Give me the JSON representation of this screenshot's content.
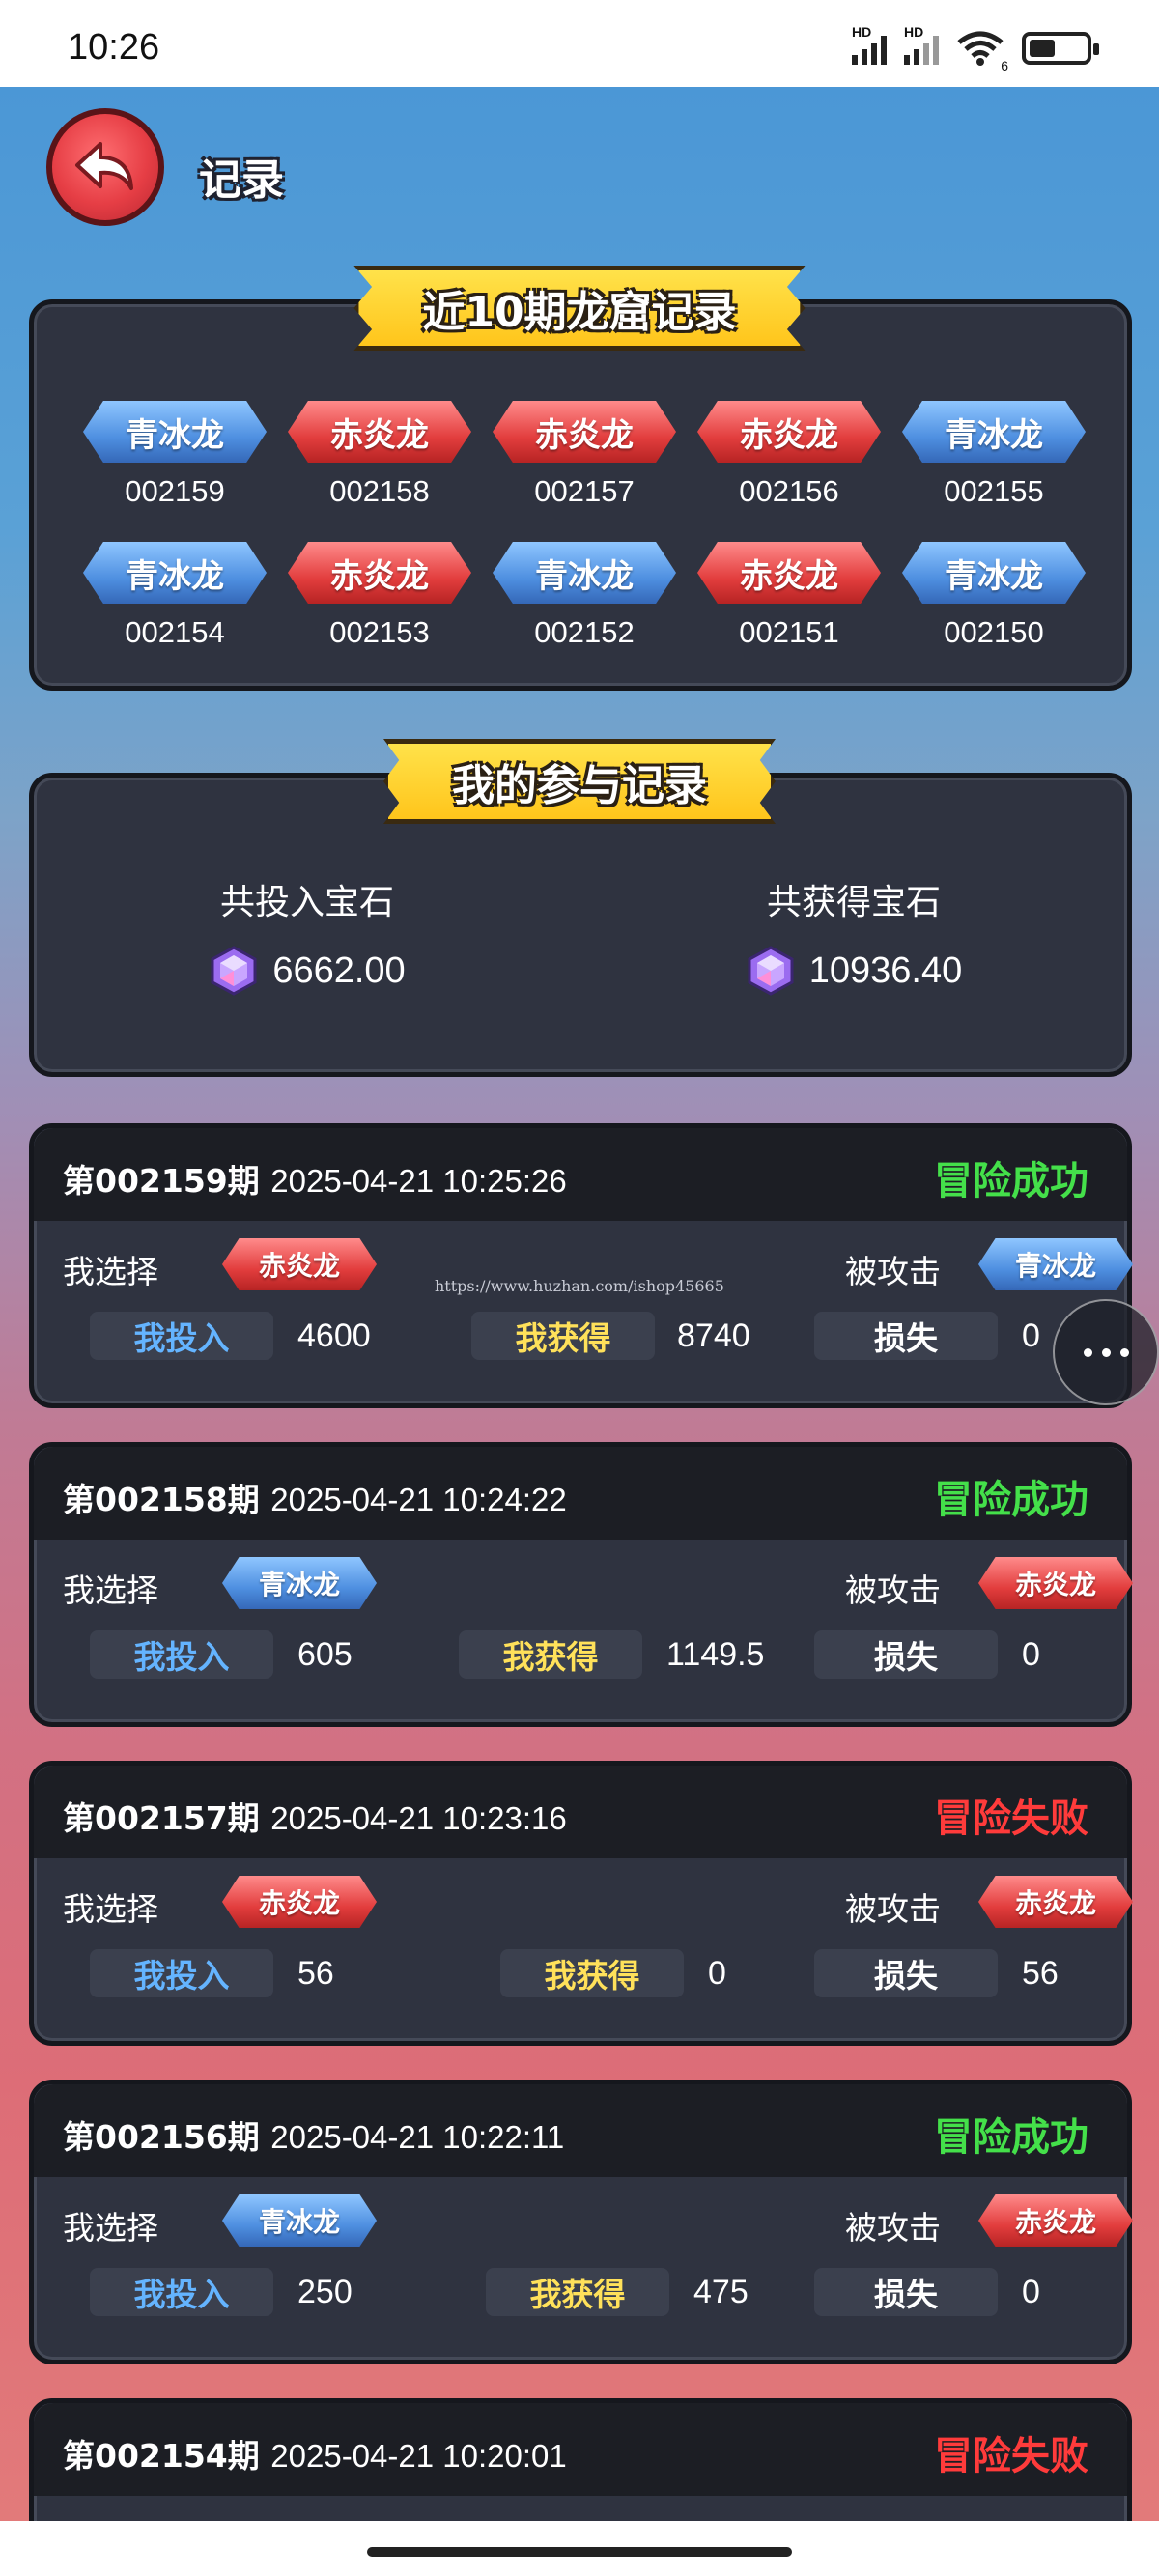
{
  "status_bar": {
    "time": "10:26",
    "signal1_label": "HD",
    "signal2_label": "HD",
    "wifi_badge": "6"
  },
  "header": {
    "title": "记录",
    "back_icon": "back-arrow-icon"
  },
  "history": {
    "title": "近10期龙窟记录",
    "items": [
      {
        "dragon": "青冰龙",
        "color": "blue",
        "period": "002159"
      },
      {
        "dragon": "赤炎龙",
        "color": "red",
        "period": "002158"
      },
      {
        "dragon": "赤炎龙",
        "color": "red",
        "period": "002157"
      },
      {
        "dragon": "赤炎龙",
        "color": "red",
        "period": "002156"
      },
      {
        "dragon": "青冰龙",
        "color": "blue",
        "period": "002155"
      },
      {
        "dragon": "青冰龙",
        "color": "blue",
        "period": "002154"
      },
      {
        "dragon": "赤炎龙",
        "color": "red",
        "period": "002153"
      },
      {
        "dragon": "青冰龙",
        "color": "blue",
        "period": "002152"
      },
      {
        "dragon": "赤炎龙",
        "color": "red",
        "period": "002151"
      },
      {
        "dragon": "青冰龙",
        "color": "blue",
        "period": "002150"
      }
    ]
  },
  "participation": {
    "title": "我的参与记录",
    "total_in_label": "共投入宝石",
    "total_in_value": "6662.00",
    "total_gain_label": "共获得宝石",
    "total_gain_value": "10936.40"
  },
  "labels": {
    "my_choice": "我选择",
    "attacked": "被攻击",
    "my_in": "我投入",
    "my_gain": "我获得",
    "loss": "损失"
  },
  "records": [
    {
      "period": "第002159期",
      "datetime": "2025-04-21 10:25:26",
      "result": "冒险成功",
      "result_type": "win",
      "choice": "赤炎龙",
      "choice_color": "red",
      "attacked": "青冰龙",
      "attacked_color": "blue",
      "in": "4600",
      "gain": "8740",
      "loss": "0"
    },
    {
      "period": "第002158期",
      "datetime": "2025-04-21 10:24:22",
      "result": "冒险成功",
      "result_type": "win",
      "choice": "青冰龙",
      "choice_color": "blue",
      "attacked": "赤炎龙",
      "attacked_color": "red",
      "in": "605",
      "gain": "1149.5",
      "loss": "0"
    },
    {
      "period": "第002157期",
      "datetime": "2025-04-21 10:23:16",
      "result": "冒险失败",
      "result_type": "lose",
      "choice": "赤炎龙",
      "choice_color": "red",
      "attacked": "赤炎龙",
      "attacked_color": "red",
      "in": "56",
      "gain": "0",
      "loss": "56"
    },
    {
      "period": "第002156期",
      "datetime": "2025-04-21 10:22:11",
      "result": "冒险成功",
      "result_type": "win",
      "choice": "青冰龙",
      "choice_color": "blue",
      "attacked": "赤炎龙",
      "attacked_color": "red",
      "in": "250",
      "gain": "475",
      "loss": "0"
    },
    {
      "period": "第002154期",
      "datetime": "2025-04-21 10:20:01",
      "result": "冒险失败",
      "result_type": "lose"
    }
  ],
  "watermark": "https://www.huzhan.com/ishop45665",
  "colors": {
    "win": "#44e04a",
    "lose": "#ff3b3b",
    "blue_tag": "#4e8fe0",
    "red_tag": "#e23d3d",
    "ribbon": "#ffc51b"
  }
}
